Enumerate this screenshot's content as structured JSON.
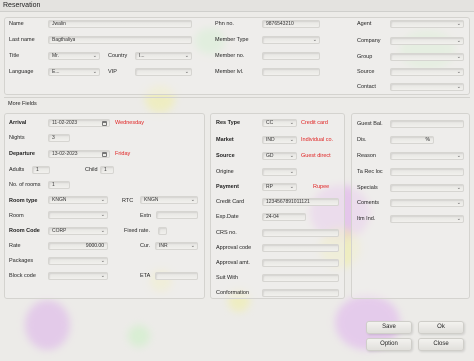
{
  "window": {
    "title": "Reservation"
  },
  "sections": {
    "more_fields": "More Fields"
  },
  "guest": {
    "name": {
      "label": "Name",
      "value": "Jwalin"
    },
    "last_name": {
      "label": "Last name",
      "value": "Bagthaliya"
    },
    "title": {
      "label": "Title",
      "value": "Mr."
    },
    "country": {
      "label": "Country",
      "value": "I..."
    },
    "language": {
      "label": "Language",
      "value": "E..."
    },
    "vip": {
      "label": "VIP",
      "value": ""
    },
    "phn": {
      "label": "Phn no.",
      "value": "9876543210"
    },
    "member_type": {
      "label": "Member Type",
      "value": ""
    },
    "member_no": {
      "label": "Member no.",
      "value": ""
    },
    "member_lvl": {
      "label": "Member lvl.",
      "value": ""
    },
    "agent": {
      "label": "Agent",
      "value": ""
    },
    "company": {
      "label": "Company",
      "value": ""
    },
    "group": {
      "label": "Group",
      "value": ""
    },
    "source": {
      "label": "Source",
      "value": ""
    },
    "contact": {
      "label": "Contact",
      "value": ""
    }
  },
  "stay": {
    "arrival": {
      "label": "Arrival",
      "value": "11-02-2023",
      "day": "Wednesday"
    },
    "nights": {
      "label": "Nights",
      "value": "3"
    },
    "departure": {
      "label": "Departure",
      "value": "13-02-2023",
      "day": "Friday"
    },
    "adults": {
      "label": "Adults",
      "value": "1"
    },
    "child": {
      "label": "Child",
      "value": "1"
    },
    "rooms": {
      "label": "No. of rooms",
      "value": "1"
    },
    "room_type": {
      "label": "Room type",
      "value": "KNGN"
    },
    "rtc": {
      "label": "RTC",
      "value": "KNGN"
    },
    "room": {
      "label": "Room",
      "value": ""
    },
    "extn": {
      "label": "Extn",
      "value": ""
    },
    "room_code": {
      "label": "Room Code",
      "value": "CORP"
    },
    "fixed_rate": {
      "label": "Fixed rate.",
      "value": ""
    },
    "rate": {
      "label": "Rate",
      "value": "9000.00"
    },
    "cur": {
      "label": "Cur.",
      "value": "INR"
    },
    "packages": {
      "label": "Packages",
      "value": ""
    },
    "block_code": {
      "label": "Block code",
      "value": ""
    },
    "eta": {
      "label": "ETA",
      "value": ""
    }
  },
  "payment": {
    "res_type": {
      "label": "Res Type",
      "value": "CC",
      "desc": "Credit card"
    },
    "market": {
      "label": "Market",
      "value": "IND",
      "desc": "Individual co."
    },
    "source": {
      "label": "Source",
      "value": "GD",
      "desc": "Guest direct"
    },
    "origine": {
      "label": "Origine",
      "value": ""
    },
    "payment": {
      "label": "Payment",
      "value": "RP",
      "desc": "Rupee"
    },
    "credit_card": {
      "label": "Credit Card",
      "value": "1234567891011121"
    },
    "exp_date": {
      "label": "Exp.Date",
      "value": "24-04"
    },
    "crs_no": {
      "label": "CRS no.",
      "value": ""
    },
    "approval_code": {
      "label": "Approval code",
      "value": ""
    },
    "approval_amt": {
      "label": "Approval amt.",
      "value": ""
    },
    "suit_with": {
      "label": "Suit With",
      "value": ""
    },
    "conformation": {
      "label": "Conformation",
      "value": ""
    }
  },
  "misc": {
    "guest_bal": {
      "label": "Guest Bal.",
      "value": ""
    },
    "dis": {
      "label": "Dis.",
      "value": "",
      "unit": "%"
    },
    "reason": {
      "label": "Reason",
      "value": ""
    },
    "ta_rec_loc": {
      "label": "Ta Rec loc",
      "value": ""
    },
    "specials": {
      "label": "Specials",
      "value": ""
    },
    "coments": {
      "label": "Coments",
      "value": ""
    },
    "itm_ind": {
      "label": "Itm Ind.",
      "value": ""
    }
  },
  "buttons": {
    "save": "Save",
    "ok": "Ok",
    "option": "Option",
    "close": "Close"
  },
  "colors": {
    "accent_red": "#e02020",
    "background": "#ecebe8"
  }
}
